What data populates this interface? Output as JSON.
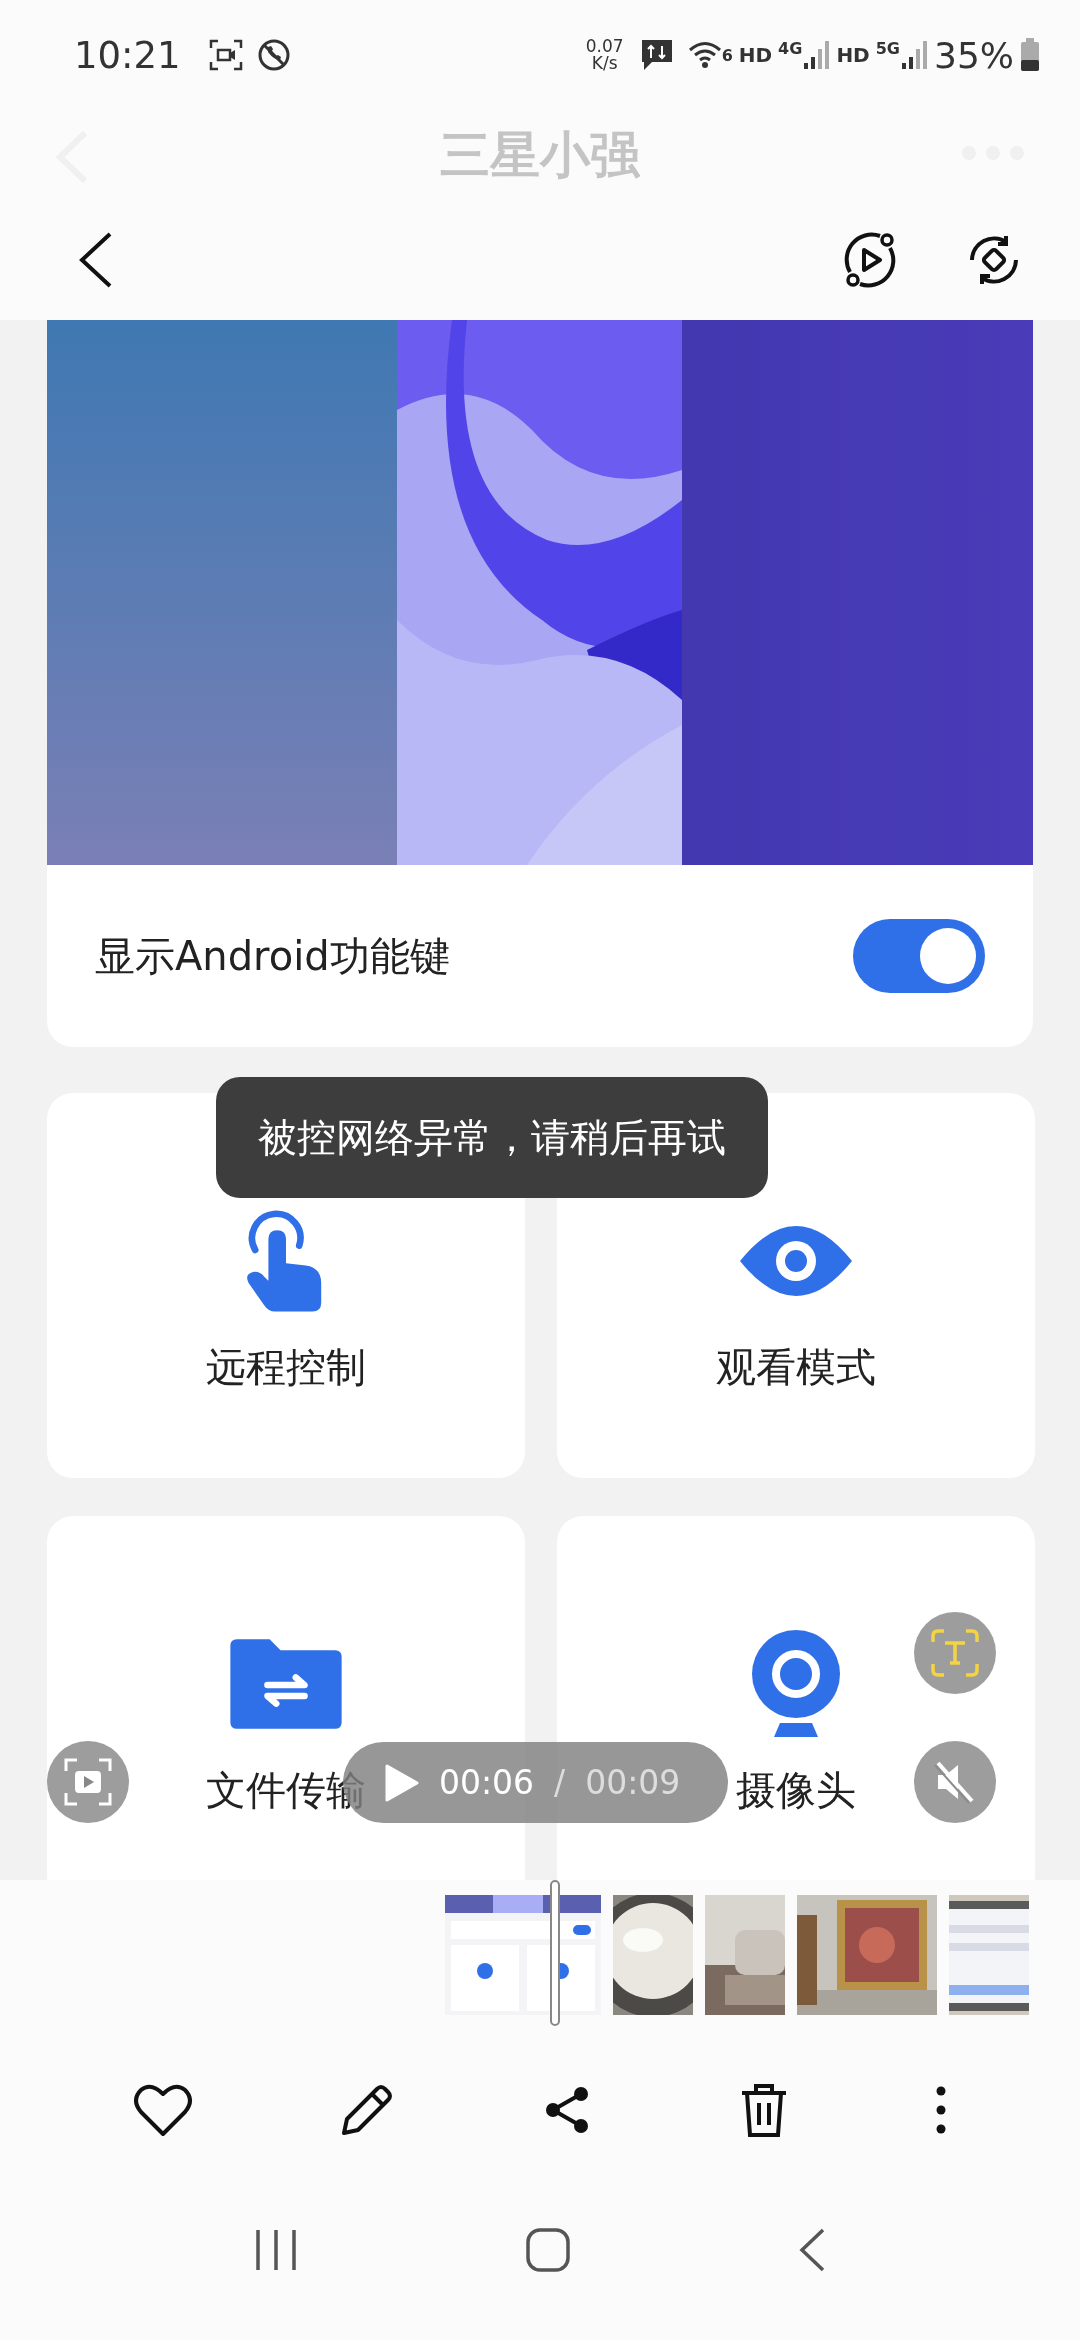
{
  "status_bar": {
    "time": "10:21",
    "speed_value": "0.07",
    "speed_unit": "K/s",
    "wifi_badge": "6",
    "signals": [
      {
        "hd": "HD",
        "type": "4G"
      },
      {
        "hd": "HD",
        "type": "5G"
      }
    ],
    "battery": "35%"
  },
  "ghost_header": {
    "title": "三星小强"
  },
  "screen": {
    "toggle_row": {
      "label": "显示Android功能键",
      "on": true
    },
    "tiles": [
      {
        "label": "远程控制"
      },
      {
        "label": "观看模式"
      },
      {
        "label": "文件传输"
      },
      {
        "label": "摄像头"
      }
    ],
    "toast": "被控网络异常，请稍后再试"
  },
  "player": {
    "current": "00:06",
    "separator": "/",
    "total": "00:09",
    "muted": true
  },
  "filmstrip": [
    {
      "kind": "picture",
      "selected": true
    },
    {
      "kind": "picture",
      "selected": false
    },
    {
      "kind": "picture",
      "selected": false
    },
    {
      "kind": "picture",
      "selected": false
    },
    {
      "kind": "picture",
      "selected": false
    }
  ]
}
